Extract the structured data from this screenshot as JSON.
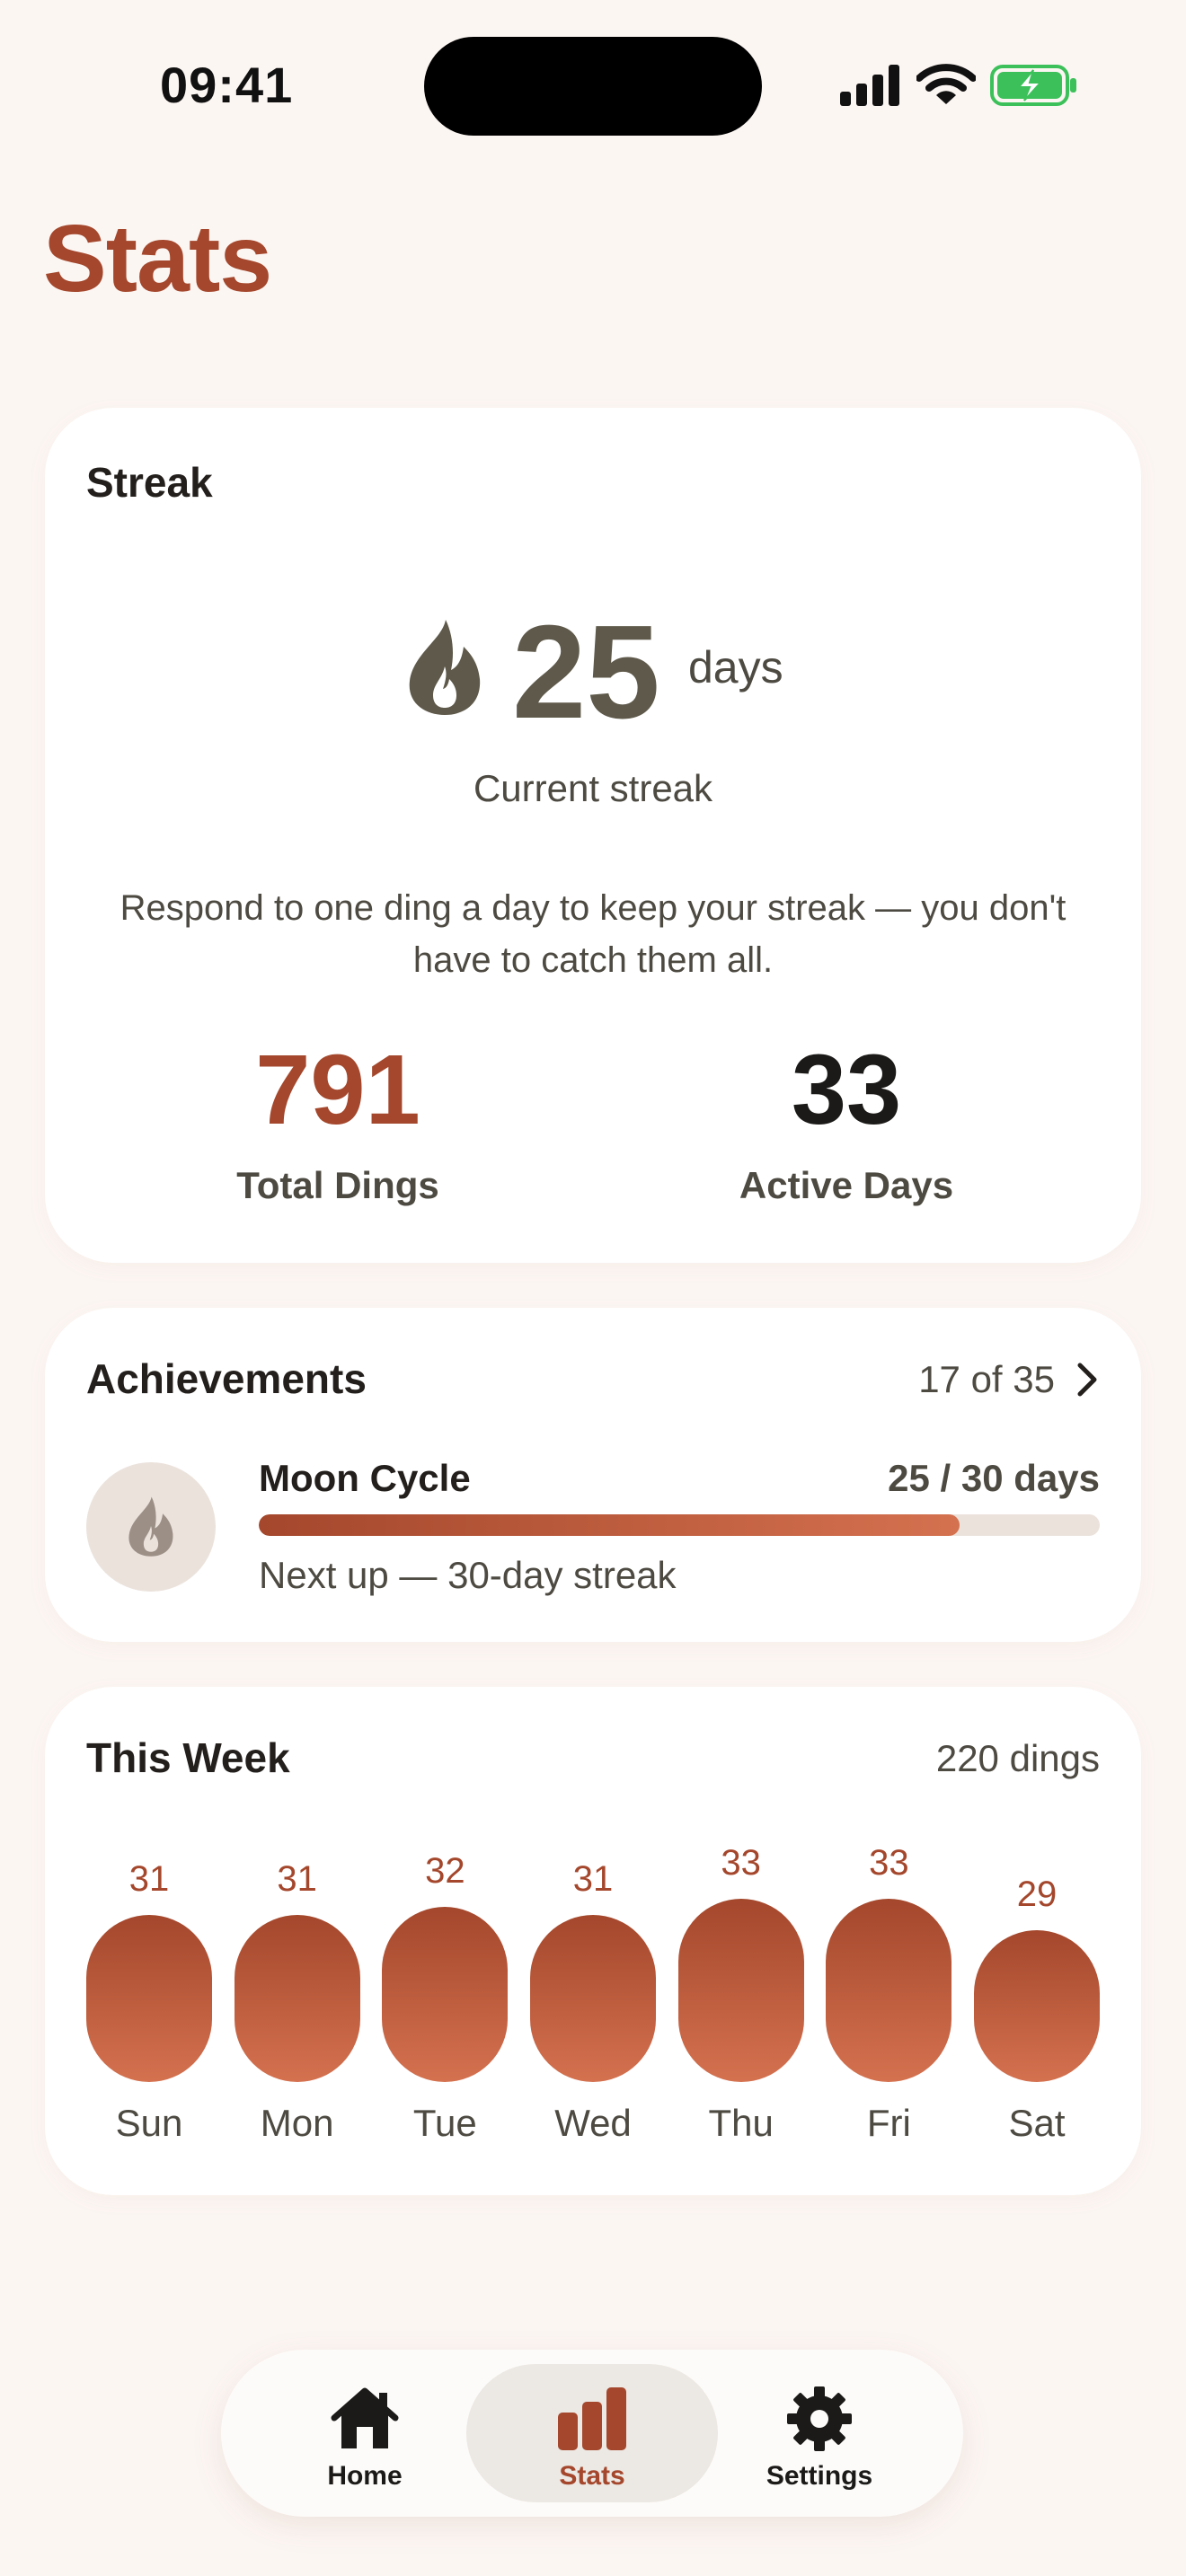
{
  "status_bar": {
    "time": "09:41",
    "icons": [
      "cellular-signal-icon",
      "wifi-icon",
      "battery-charging-icon"
    ]
  },
  "page": {
    "title": "Stats"
  },
  "streak": {
    "heading": "Streak",
    "icon": "flame-icon",
    "value": "25",
    "unit": "days",
    "caption": "Current streak",
    "note": "Respond to one ding a day to keep your streak — you don't have to catch them all.",
    "total_dings": {
      "value": "791",
      "label": "Total Dings"
    },
    "active_days": {
      "value": "33",
      "label": "Active Days"
    }
  },
  "achievements": {
    "heading": "Achievements",
    "count": "17 of 35",
    "chevron": "chevron-right-icon",
    "current": {
      "icon": "flame-icon",
      "name": "Moon Cycle",
      "progress_text": "25 / 30 days",
      "progress": 0.833,
      "next": "Next up — 30-day streak"
    }
  },
  "week": {
    "heading": "This Week",
    "total": "220 dings",
    "days": [
      {
        "label": "Sun",
        "value": "31"
      },
      {
        "label": "Mon",
        "value": "31"
      },
      {
        "label": "Tue",
        "value": "32"
      },
      {
        "label": "Wed",
        "value": "31"
      },
      {
        "label": "Thu",
        "value": "33"
      },
      {
        "label": "Fri",
        "value": "33"
      },
      {
        "label": "Sat",
        "value": "29"
      }
    ]
  },
  "tabs": [
    {
      "label": "Home",
      "icon": "home-icon",
      "active": false
    },
    {
      "label": "Stats",
      "icon": "bar-chart-icon",
      "active": true
    },
    {
      "label": "Settings",
      "icon": "gear-icon",
      "active": false
    }
  ],
  "colors": {
    "background": "#fcf6f3",
    "accent": "#a4472c",
    "accent_light": "#d4714f",
    "muted_text": "#4d4a42",
    "flame": "#5e594a",
    "track": "#ebe2dc",
    "battery_green": "#3cc15a"
  }
}
